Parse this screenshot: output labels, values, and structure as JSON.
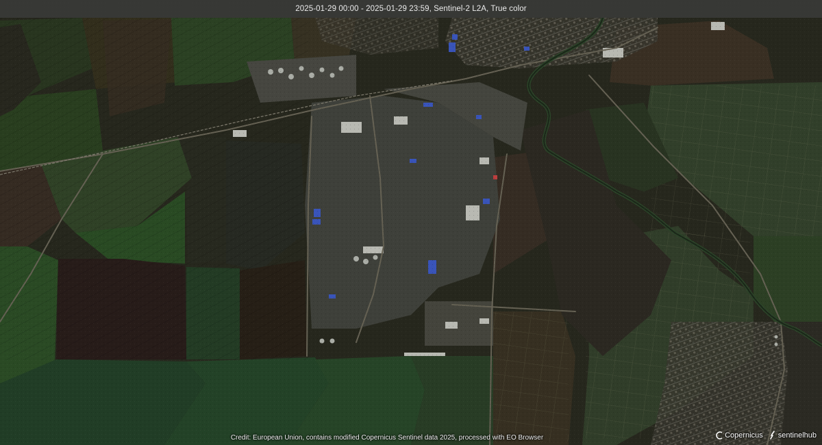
{
  "header": {
    "title": "2025-01-29 00:00 - 2025-01-29 23:59, Sentinel-2 L2A, True color"
  },
  "footer": {
    "credit": "Credit: European Union, contains modified Copernicus Sentinel data 2025, processed with EO Browser",
    "logos": [
      {
        "text": "Copernicus",
        "icon": "copernicus-icon"
      },
      {
        "text": "sentinelhub",
        "icon": "sentinelhub-icon"
      }
    ]
  },
  "colors": {
    "field_green": "#2f4a25",
    "field_dark": "#262a1d",
    "field_brown": "#3c3326",
    "industrial": "#5a5c55",
    "roofs_blue": "#3b56b8",
    "river": "#2c3a28",
    "top_bar": "#3c3e3c"
  }
}
